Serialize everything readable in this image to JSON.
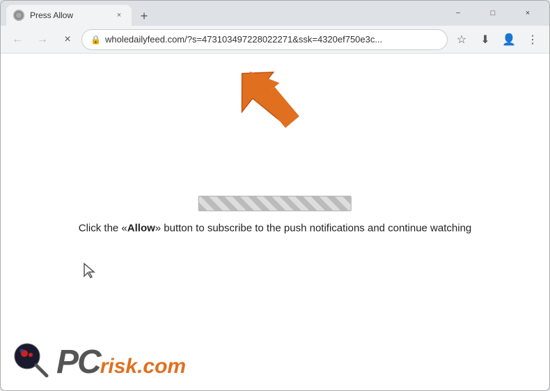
{
  "window": {
    "title": "Press Allow",
    "controls": {
      "minimize": "−",
      "maximize": "□",
      "close": "×"
    }
  },
  "tabs": [
    {
      "label": "Press Allow",
      "active": true
    }
  ],
  "new_tab_icon": "+",
  "nav": {
    "back_icon": "←",
    "forward_icon": "→",
    "reload_icon": "×",
    "url": "wholedailyfeed.com/?s=473103497228022271&ssk=4320ef750e3c...",
    "lock_icon": "🔒",
    "star_icon": "☆",
    "profile_icon": "👤",
    "menu_icon": "⋮",
    "download_icon": "⬇"
  },
  "page": {
    "subscribe_text": "Click the «Allow» button to subscribe to the push notifications and continue watching"
  },
  "watermark": {
    "text_pc": "PC",
    "text_risk": "risk.com"
  }
}
